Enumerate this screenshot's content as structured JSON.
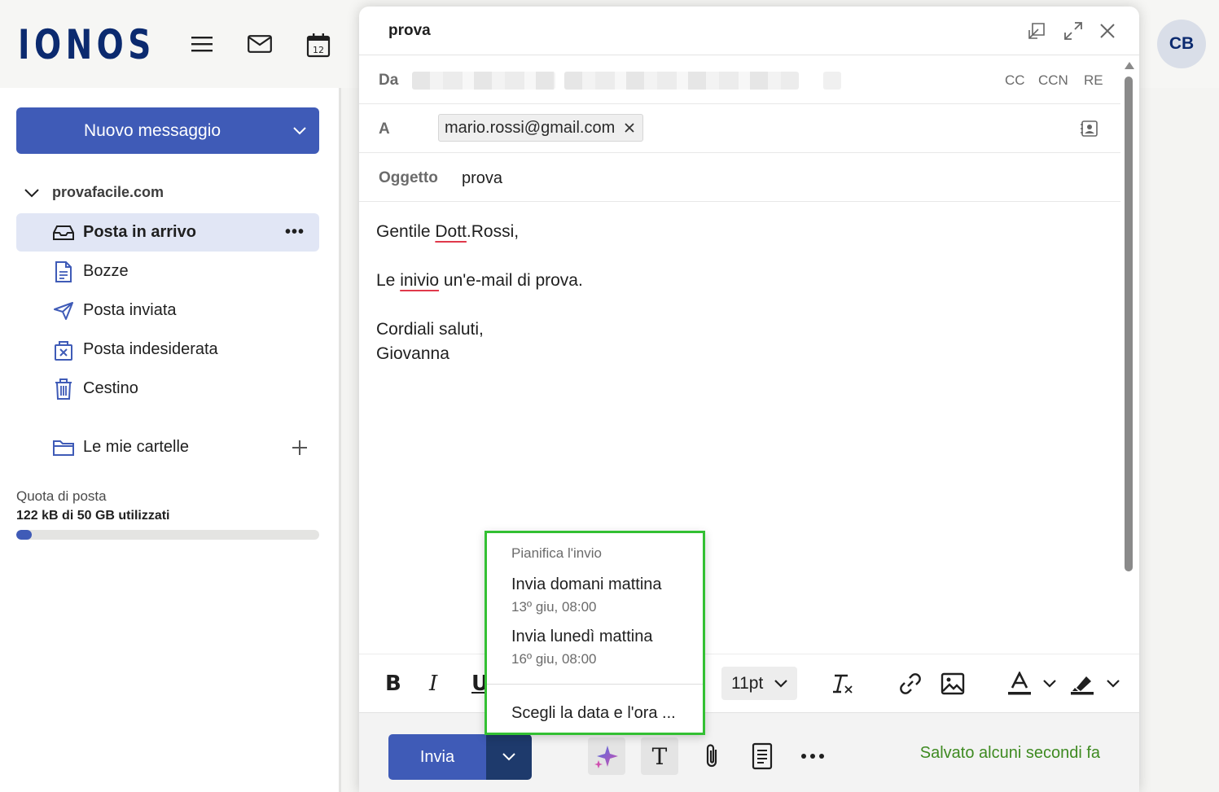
{
  "app": {
    "logo": "IONOS",
    "avatar_initials": "CB",
    "calendar_day": "12"
  },
  "sidebar": {
    "new_message": "Nuovo messaggio",
    "account": "provafacile.com",
    "items": [
      {
        "label": "Posta in arrivo",
        "icon": "inbox-icon",
        "active": true
      },
      {
        "label": "Bozze",
        "icon": "draft-icon"
      },
      {
        "label": "Posta inviata",
        "icon": "send-icon"
      },
      {
        "label": "Posta indesiderata",
        "icon": "spam-icon"
      },
      {
        "label": "Cestino",
        "icon": "trash-icon"
      }
    ],
    "folders_label": "Le mie cartelle",
    "more_label": "•••",
    "quota_label": "Quota di posta",
    "quota_value": "122 kB di 50 GB utilizzati",
    "quota_fraction": 0.05
  },
  "compose": {
    "title": "prova",
    "from_label": "Da",
    "to_label": "A",
    "cc": "CC",
    "bcc": "CCN",
    "reply": "RE",
    "recipient": "mario.rossi@gmail.com",
    "subject_label": "Oggetto",
    "subject_value": "prova",
    "body": {
      "greeting_pre": "Gentile ",
      "greeting_word": "Dott",
      "greeting_post": ".Rossi,",
      "line2_pre": "Le ",
      "line2_word": "inivio",
      "line2_post": " un'e-mail di prova.",
      "closing": "Cordiali saluti,",
      "signature": "Giovanna"
    },
    "font_size": "11pt",
    "send_label": "Invia",
    "saved_status": "Salvato alcuni secondi fa"
  },
  "schedule": {
    "title": "Pianifica l'invio",
    "options": [
      {
        "label": "Invia domani mattina",
        "time": "13º giu, 08:00"
      },
      {
        "label": "Invia lunedì mattina",
        "time": "16º giu, 08:00"
      }
    ],
    "custom": "Scegli la data e l'ora ..."
  },
  "colors": {
    "brand": "#0b2a6f",
    "accent": "#3f5bb7",
    "saved": "#3e8a21",
    "highlight": "#33c033"
  }
}
